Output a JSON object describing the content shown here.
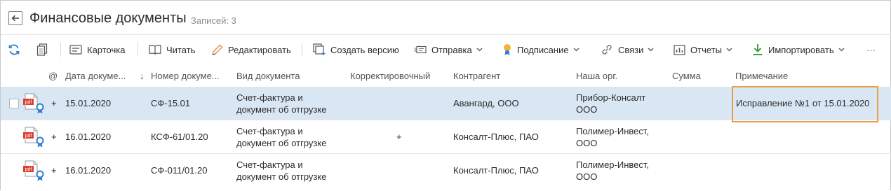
{
  "header": {
    "title": "Финансовые документы",
    "records": "Записей: 3"
  },
  "toolbar": {
    "card": "Карточка",
    "read": "Читать",
    "edit": "Редактировать",
    "create_version": "Создать версию",
    "send": "Отправка",
    "sign": "Подписание",
    "links": "Связи",
    "reports": "Отчеты",
    "import": "Импортировать",
    "more": "···"
  },
  "columns": {
    "attach": "@",
    "date": "Дата докуме...",
    "sort_arrow": "↓",
    "number": "Номер докуме...",
    "doc_type": "Вид документа",
    "corrective": "Корректировочный",
    "counterparty": "Контрагент",
    "our_org": "Наша орг.",
    "sum": "Сумма",
    "note": "Примечание"
  },
  "rows": [
    {
      "attach": "+",
      "date": "15.01.2020",
      "number": "СФ-15.01",
      "doc_type_1": "Счет-фактура и",
      "doc_type_2": "документ об отгрузке",
      "corrective": "",
      "counterparty": "Авангард, ООО",
      "our_org_1": "Прибор-Консалт",
      "our_org_2": "ООО",
      "sum": "",
      "note": "Исправление №1 от 15.01.2020"
    },
    {
      "attach": "+",
      "date": "16.01.2020",
      "number": "КСФ-61/01.20",
      "doc_type_1": "Счет-фактура и",
      "doc_type_2": "документ об отгрузке",
      "corrective": "+",
      "counterparty": "Консалт-Плюс, ПАО",
      "our_org_1": "Полимер-Инвест,",
      "our_org_2": "ООО",
      "sum": "",
      "note": ""
    },
    {
      "attach": "+",
      "date": "16.01.2020",
      "number": "СФ-011/01.20",
      "doc_type_1": "Счет-фактура и",
      "doc_type_2": "документ об отгрузке",
      "corrective": "",
      "counterparty": "Консалт-Плюс, ПАО",
      "our_org_1": "Полимер-Инвест,",
      "our_org_2": "ООО",
      "sum": "",
      "note": ""
    }
  ],
  "icons": {
    "pdf_label": "pdf",
    "accent": "#ee9b47",
    "selected_row": "#d9e7f5",
    "pdf_red": "#d9412f",
    "signature_blue": "#2f7fcf"
  }
}
